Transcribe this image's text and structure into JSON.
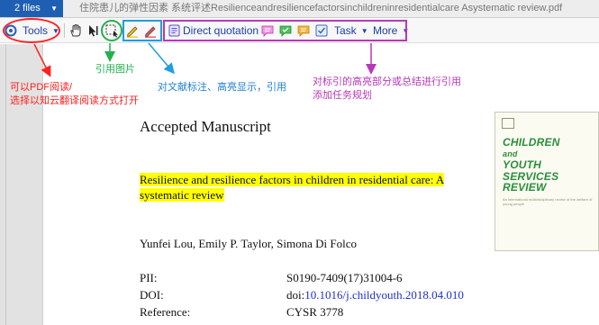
{
  "titlebar": {
    "files_tab": "2 files",
    "document_title": "住院患儿的弹性因素 系统评述Resilienceandresiliencefactorsinchildreninresidentialcare  Asystematic  review.pdf"
  },
  "toolbar": {
    "tools_label": "Tools",
    "direct_quotation_label": "Direct quotation",
    "task_label": "Task",
    "more_label": "More"
  },
  "annotations": {
    "red_line1": "可以PDF阅读/",
    "red_line2": "选择以知云翻译阅读方式打开",
    "green": "引用图片",
    "blue": "对文献标注、高亮显示，引用",
    "purple_line1": "对标引的高亮部分或总结进行引用",
    "purple_line2": "添加任务规划"
  },
  "document": {
    "heading": "Accepted Manuscript",
    "title_line1": "Resilience and resilience factors in children in residential care: A",
    "title_line2": "systematic review",
    "authors": "Yunfei Lou, Emily P. Taylor, Simona Di Folco",
    "meta": {
      "pii_label": "PII:",
      "pii_value": "S0190-7409(17)31004-6",
      "doi_label": "DOI:",
      "doi_prefix": "doi:",
      "doi_link": "10.1016/j.childyouth.2018.04.010",
      "reference_label": "Reference:",
      "reference_value": "CYSR 3778"
    }
  },
  "cover": {
    "title_lines": [
      "CHILDREN",
      "and",
      "YOUTH",
      "SERVICES",
      "REVIEW"
    ],
    "subtitle": "An international multidisciplinary review of the welfare of young people"
  },
  "colors": {
    "annotation_red": "#ff1f1f",
    "annotation_green": "#22b14c",
    "annotation_blue": "#1f9ee0",
    "annotation_purple": "#b838b8",
    "highlight": "#ffff00",
    "files_tab": "#1f5fb3"
  }
}
